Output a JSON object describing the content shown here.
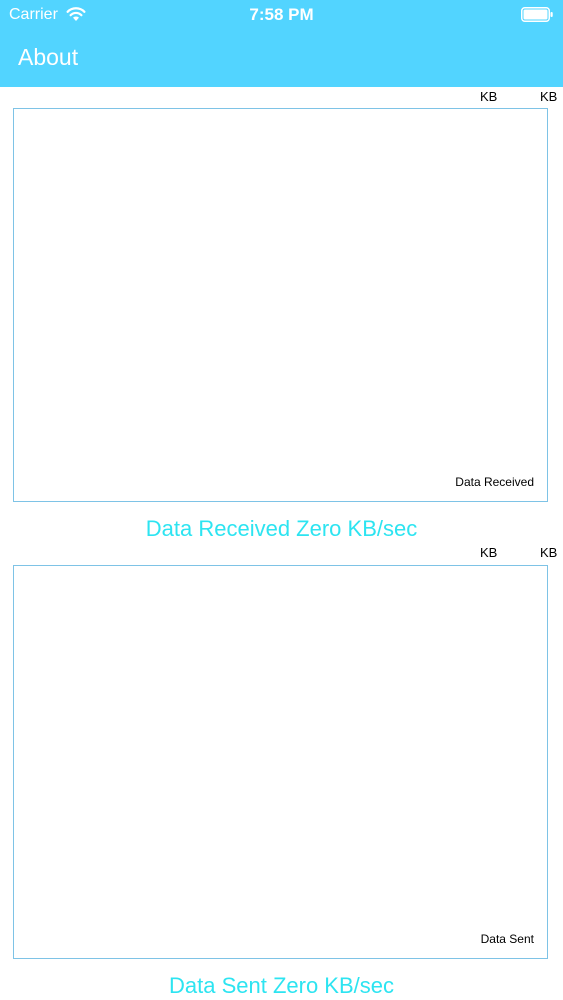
{
  "status_bar": {
    "carrier": "Carrier",
    "time": "7:58 PM",
    "icons": [
      "wifi-icon",
      "battery-icon"
    ]
  },
  "nav": {
    "title": "About"
  },
  "colors": {
    "header_bg": "#52d4ff",
    "chart_border": "#7ec3e6",
    "caption_text": "#2de4f1"
  },
  "charts": [
    {
      "unit_left": "KB",
      "unit_right": "KB",
      "legend": "Data Received",
      "caption": "Data Received Zero KB/sec"
    },
    {
      "unit_left": "KB",
      "unit_right": "KB",
      "legend": "Data Sent",
      "caption": "Data Sent Zero KB/sec"
    }
  ],
  "chart_data": [
    {
      "type": "line",
      "title": "",
      "series": [],
      "grid": false,
      "legend_position": "bottom-right"
    },
    {
      "type": "line",
      "title": "",
      "series": [],
      "grid": false,
      "legend_position": "bottom-right"
    }
  ]
}
